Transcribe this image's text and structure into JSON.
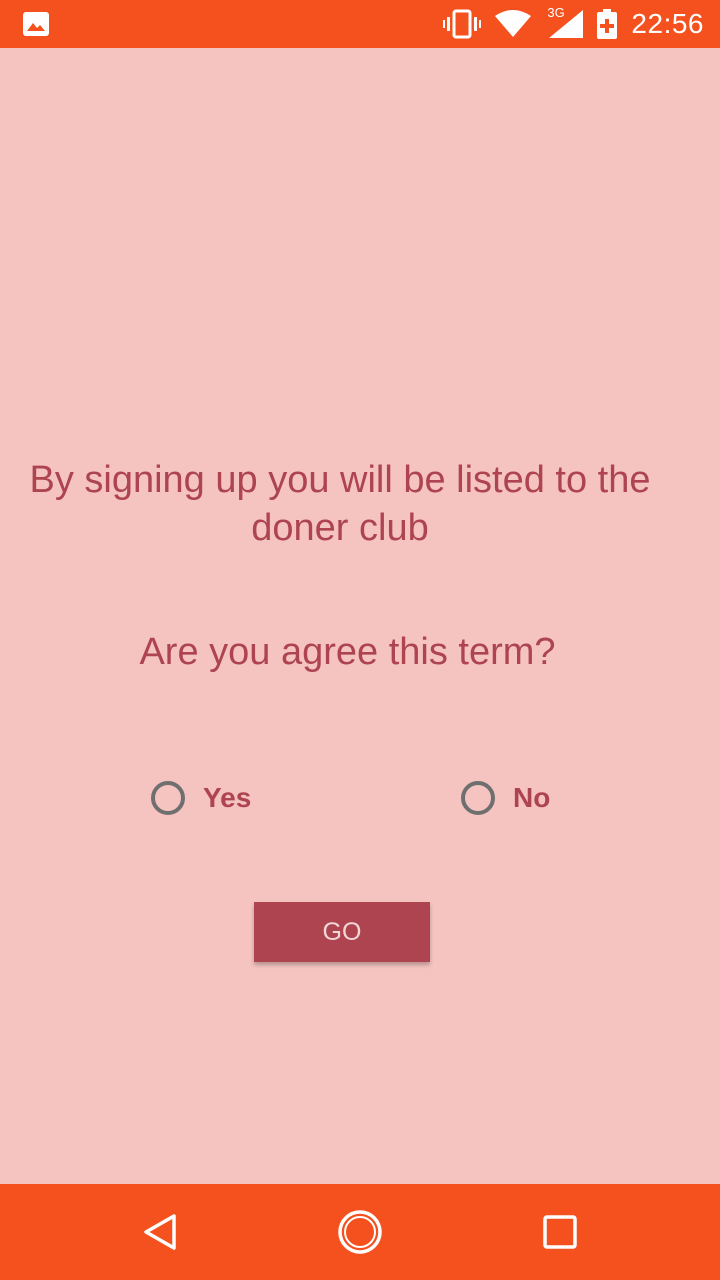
{
  "status_bar": {
    "time": "22:56",
    "network_type": "3G",
    "icons": [
      "image-notification-icon",
      "vibrate-icon",
      "wifi-icon",
      "cell-signal-icon",
      "battery-charging-icon"
    ]
  },
  "main": {
    "message": "By signing up you will be listed to the doner club",
    "question": "Are you agree this term?",
    "options": {
      "yes": "Yes",
      "no": "No"
    },
    "go_label": "GO"
  },
  "nav_bar": {
    "icons": [
      "back-icon",
      "home-icon",
      "recents-icon"
    ]
  },
  "colors": {
    "background": "#f5c4c0",
    "accent": "#ad4450",
    "system_bar": "#f4511e"
  }
}
